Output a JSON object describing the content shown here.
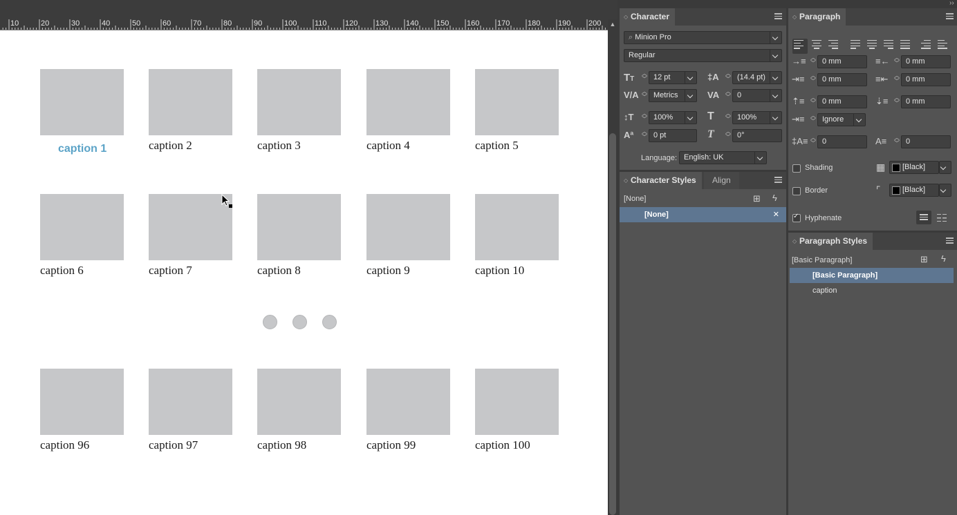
{
  "ruler": {
    "labels": [
      "10",
      "20",
      "30",
      "40",
      "50",
      "60",
      "70",
      "80",
      "90",
      "100",
      "110",
      "120",
      "130",
      "140",
      "150",
      "160",
      "170",
      "180",
      "190",
      "200"
    ]
  },
  "canvas": {
    "captions": {
      "row1": [
        "caption 1",
        "caption 2",
        "caption 3",
        "caption 4",
        "caption 5"
      ],
      "row2": [
        "caption 6",
        "caption 7",
        "caption 8",
        "caption 9",
        "caption 10"
      ],
      "row3": [
        "caption 96",
        "caption 97",
        "caption 98",
        "caption 99",
        "caption 100"
      ]
    }
  },
  "character": {
    "tab": "Character",
    "font_family": "Minion Pro",
    "font_style": "Regular",
    "size": "12 pt",
    "leading": "(14.4 pt)",
    "kerning": "Metrics",
    "tracking": "0",
    "vscale": "100%",
    "hscale": "100%",
    "baseline": "0 pt",
    "skew": "0°",
    "language_label": "Language:",
    "language": "English: UK"
  },
  "char_styles": {
    "tabs": [
      "Character Styles",
      "Align"
    ],
    "current": "[None]",
    "items": [
      "[None]"
    ]
  },
  "paragraph": {
    "tab": "Paragraph",
    "left_indent": "0 mm",
    "right_indent": "0 mm",
    "first_line_indent": "0 mm",
    "last_line_indent": "0 mm",
    "space_before": "0 mm",
    "space_after": "0 mm",
    "align_to_grid": "Ignore",
    "drop_cap_lines": "0",
    "drop_cap_chars": "0",
    "shading_label": "Shading",
    "shading_color": "[Black]",
    "border_label": "Border",
    "border_color": "[Black]",
    "hyphenate_label": "Hyphenate"
  },
  "para_styles": {
    "tab": "Paragraph Styles",
    "current": "[Basic Paragraph]",
    "items": [
      "[Basic Paragraph]",
      "caption"
    ]
  }
}
